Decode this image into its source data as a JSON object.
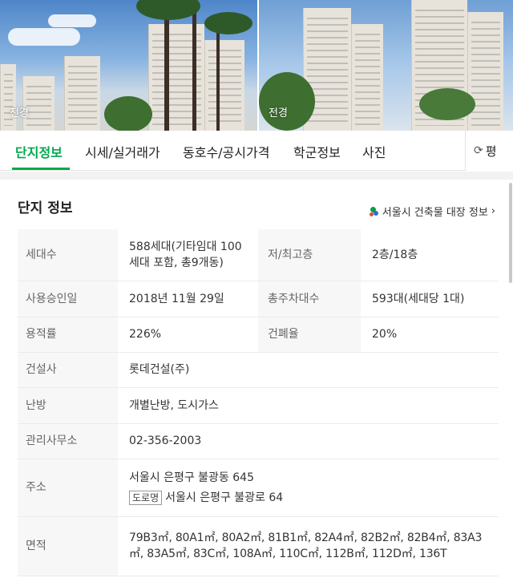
{
  "photos": [
    {
      "label": "전경"
    },
    {
      "label": "전경"
    }
  ],
  "tabs": [
    {
      "label": "단지정보",
      "active": true
    },
    {
      "label": "시세/실거래가"
    },
    {
      "label": "동호수/공시가격"
    },
    {
      "label": "학군정보"
    },
    {
      "label": "사진"
    }
  ],
  "tab_right": {
    "label": "평",
    "icon": "refresh-icon"
  },
  "section": {
    "title": "단지 정보",
    "source_link": "서울시 건축물 대장 정보",
    "source_icon": "seoul-logo-icon"
  },
  "info": {
    "households_label": "세대수",
    "households_value": "588세대(기타임대 100세대 포함, 총9개동)",
    "floors_label": "저/최고층",
    "floors_value": "2층/18층",
    "approval_label": "사용승인일",
    "approval_value": "2018년 11월 29일",
    "parking_label": "총주차대수",
    "parking_value": "593대(세대당 1대)",
    "far_label": "용적률",
    "far_value": "226%",
    "bcr_label": "건폐율",
    "bcr_value": "20%",
    "builder_label": "건설사",
    "builder_value": "롯데건설(주)",
    "heating_label": "난방",
    "heating_value": "개별난방, 도시가스",
    "office_label": "관리사무소",
    "office_value": "02-356-2003",
    "address_label": "주소",
    "address_jibun": "서울시 은평구 불광동 645",
    "road_badge": "도로명",
    "address_road": "서울시 은평구 불광로 64",
    "area_label": "면적",
    "area_value": "79B3㎡, 80A1㎡, 80A2㎡, 81B1㎡, 82A4㎡, 82B2㎡, 82B4㎡, 83A3㎡, 83A5㎡, 83C㎡, 108A㎡, 110C㎡, 112B㎡, 112D㎡, 136T"
  },
  "colors": {
    "accent": "#03a94d",
    "label_bg": "#f7f7f7",
    "border": "#ebebeb"
  }
}
